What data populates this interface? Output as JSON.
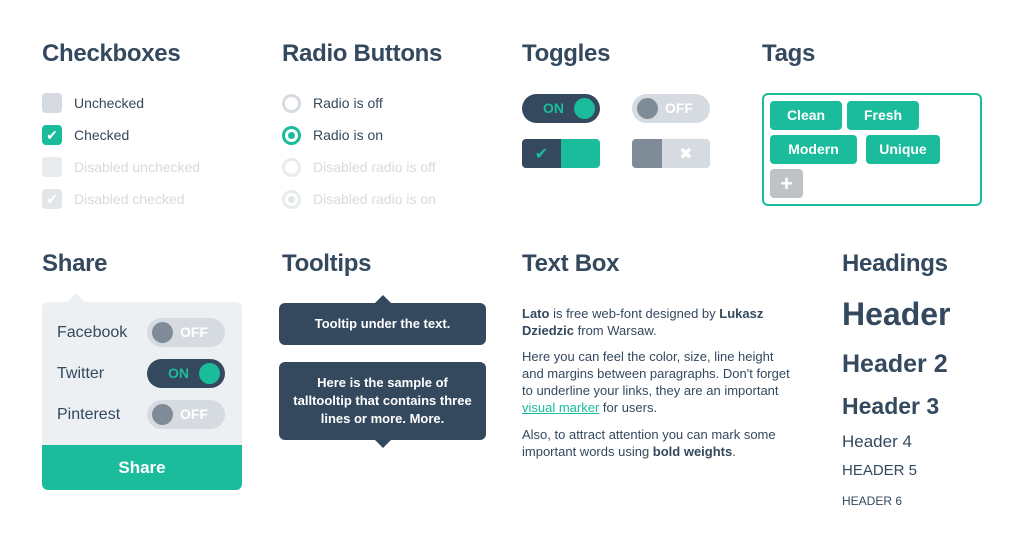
{
  "sections": {
    "checkboxes": "Checkboxes",
    "radios": "Radio Buttons",
    "toggles": "Toggles",
    "tags": "Tags",
    "share": "Share",
    "tooltips": "Tooltips",
    "textbox": "Text Box",
    "headings": "Headings"
  },
  "checkboxes": [
    {
      "label": "Unchecked",
      "state": "unchecked"
    },
    {
      "label": "Checked",
      "state": "checked"
    },
    {
      "label": "Disabled unchecked",
      "state": "disabled-unchecked"
    },
    {
      "label": "Disabled checked",
      "state": "disabled-checked"
    }
  ],
  "radios": [
    {
      "label": "Radio is off",
      "state": "off"
    },
    {
      "label": "Radio is on",
      "state": "on"
    },
    {
      "label": "Disabled radio is off",
      "state": "disabled-off"
    },
    {
      "label": "Disabled radio is on",
      "state": "disabled-on"
    }
  ],
  "toggles": {
    "on_label": "ON",
    "off_label": "OFF",
    "check_icon": "✔",
    "cross_icon": "✖"
  },
  "tags": {
    "items": [
      "Clean",
      "Fresh",
      "Modern",
      "Unique"
    ],
    "add_icon": "+"
  },
  "share": {
    "rows": [
      {
        "name": "Facebook",
        "state": "OFF"
      },
      {
        "name": "Twitter",
        "state": "ON"
      },
      {
        "name": "Pinterest",
        "state": "OFF"
      }
    ],
    "button": "Share"
  },
  "tooltips": {
    "short": "Tooltip under the text.",
    "long": "Here is the sample of talltooltip that contains three lines or more. More."
  },
  "textbox": {
    "p1_bold1": "Lato",
    "p1_text1": " is free web-font designed by ",
    "p1_bold2": "Lukasz Dziedzic",
    "p1_text2": " from Warsaw.",
    "p2_text1": "Here you can feel the color, size, line height and margins between paragraphs. Don't forget to underline your links, they are an important ",
    "p2_link": "visual marker",
    "p2_text2": " for users.",
    "p3_text1": "Also, to attract attention you can mark some important words using ",
    "p3_bold": "bold weights",
    "p3_text2": "."
  },
  "headings": {
    "h1": "Header",
    "h2": "Header 2",
    "h3": "Header 3",
    "h4": "Header 4",
    "h5": "HEADER 5",
    "h6": "HEADER 6"
  },
  "colors": {
    "accent": "#1abc9c",
    "dark": "#34495e",
    "light": "#ecf0f3"
  }
}
